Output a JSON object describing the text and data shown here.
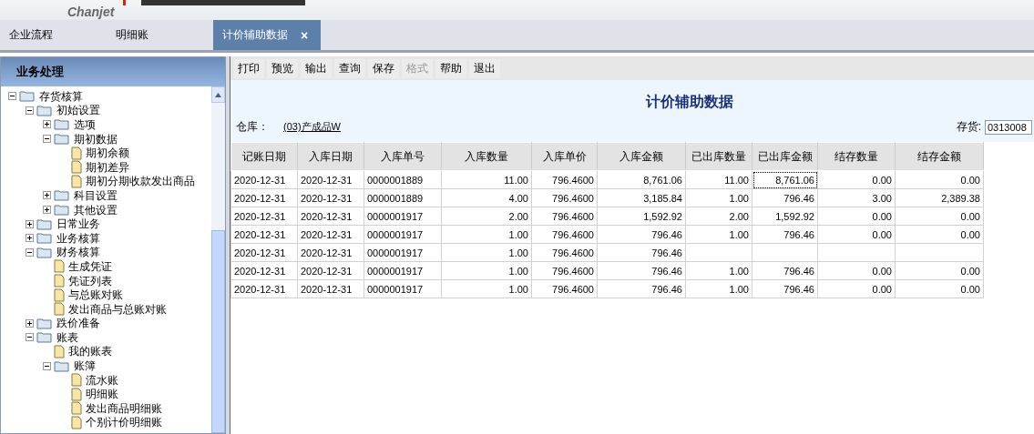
{
  "banner": {
    "logo": "Chanjet"
  },
  "tabs": [
    {
      "label": "企业流程",
      "selected": false
    },
    {
      "label": "明细账",
      "selected": false
    },
    {
      "label": "计价辅助数据",
      "selected": true,
      "close": "×"
    }
  ],
  "sidebar": {
    "title": "业务处理",
    "tree": [
      {
        "label": "存货核算",
        "kind": "folder",
        "expanded": true,
        "children": [
          {
            "label": "初始设置",
            "kind": "folder",
            "expanded": true,
            "children": [
              {
                "label": "选项",
                "kind": "folder",
                "expanded": false
              },
              {
                "label": "期初数据",
                "kind": "folder",
                "expanded": true,
                "children": [
                  {
                    "label": "期初余额",
                    "kind": "doc"
                  },
                  {
                    "label": "期初差异",
                    "kind": "doc"
                  },
                  {
                    "label": "期初分期收款发出商品",
                    "kind": "doc"
                  }
                ]
              },
              {
                "label": "科目设置",
                "kind": "folder",
                "expanded": false
              },
              {
                "label": "其他设置",
                "kind": "folder",
                "expanded": false
              }
            ]
          },
          {
            "label": "日常业务",
            "kind": "folder",
            "expanded": false
          },
          {
            "label": "业务核算",
            "kind": "folder",
            "expanded": false
          },
          {
            "label": "财务核算",
            "kind": "folder",
            "expanded": true,
            "children": [
              {
                "label": "生成凭证",
                "kind": "doc"
              },
              {
                "label": "凭证列表",
                "kind": "doc"
              },
              {
                "label": "与总账对账",
                "kind": "doc"
              },
              {
                "label": "发出商品与总账对账",
                "kind": "doc"
              }
            ]
          },
          {
            "label": "跌价准备",
            "kind": "folder",
            "expanded": false
          },
          {
            "label": "账表",
            "kind": "folder",
            "expanded": true,
            "children": [
              {
                "label": "我的账表",
                "kind": "doc"
              },
              {
                "label": "账簿",
                "kind": "folder",
                "expanded": true,
                "children": [
                  {
                    "label": "流水账",
                    "kind": "doc"
                  },
                  {
                    "label": "明细账",
                    "kind": "doc"
                  },
                  {
                    "label": "发出商品明细账",
                    "kind": "doc"
                  },
                  {
                    "label": "个别计价明细账",
                    "kind": "doc"
                  }
                ]
              }
            ]
          }
        ]
      }
    ]
  },
  "toolbar": [
    {
      "label": "打印",
      "disabled": false
    },
    {
      "label": "预览",
      "disabled": false
    },
    {
      "label": "输出",
      "disabled": false
    },
    {
      "label": "查询",
      "disabled": false
    },
    {
      "label": "保存",
      "disabled": false
    },
    {
      "label": "格式",
      "disabled": true
    },
    {
      "label": "帮助",
      "disabled": false
    },
    {
      "label": "退出",
      "disabled": false
    }
  ],
  "report": {
    "title": "计价辅助数据",
    "warehouse_label": "仓库：",
    "warehouse": "(03)产成品W",
    "inventory_label": "存货:",
    "inventory": "0313008"
  },
  "table": {
    "columns": [
      {
        "label": "记账日期",
        "kind": "text",
        "current": false
      },
      {
        "label": "入库日期",
        "kind": "text",
        "current": false
      },
      {
        "label": "入库单号",
        "kind": "text",
        "current": false
      },
      {
        "label": "入库数量",
        "kind": "number",
        "current": false
      },
      {
        "label": "入库单价",
        "kind": "number",
        "current": false
      },
      {
        "label": "入库金额",
        "kind": "number",
        "current": false
      },
      {
        "label": "已出库数量",
        "kind": "number",
        "current": false
      },
      {
        "label": "已出库金额",
        "kind": "number",
        "current": true
      },
      {
        "label": "结存数量",
        "kind": "number",
        "current": false
      },
      {
        "label": "结存金额",
        "kind": "number",
        "current": false
      }
    ],
    "rows": [
      {
        "selected": true,
        "cells": [
          "2020-12-31",
          "2020-12-31",
          "0000001889",
          "11.00",
          "796.4600",
          "8,761.06",
          "11.00",
          "8,761.06",
          "0.00",
          "0.00"
        ]
      },
      {
        "selected": false,
        "cells": [
          "2020-12-31",
          "2020-12-31",
          "0000001889",
          "4.00",
          "796.4600",
          "3,185.84",
          "1.00",
          "796.46",
          "3.00",
          "2,389.38"
        ]
      },
      {
        "selected": false,
        "cells": [
          "2020-12-31",
          "2020-12-31",
          "0000001917",
          "2.00",
          "796.4600",
          "1,592.92",
          "2.00",
          "1,592.92",
          "0.00",
          "0.00"
        ]
      },
      {
        "selected": false,
        "cells": [
          "2020-12-31",
          "2020-12-31",
          "0000001917",
          "1.00",
          "796.4600",
          "796.46",
          "1.00",
          "796.46",
          "0.00",
          "0.00"
        ]
      },
      {
        "selected": false,
        "cells": [
          "2020-12-31",
          "2020-12-31",
          "0000001917",
          "1.00",
          "796.4600",
          "796.46",
          "",
          "",
          "",
          ""
        ]
      },
      {
        "selected": false,
        "cells": [
          "2020-12-31",
          "2020-12-31",
          "0000001917",
          "1.00",
          "796.4600",
          "796.46",
          "1.00",
          "796.46",
          "0.00",
          "0.00"
        ]
      },
      {
        "selected": false,
        "cells": [
          "2020-12-31",
          "2020-12-31",
          "0000001917",
          "1.00",
          "796.4600",
          "796.46",
          "1.00",
          "796.46",
          "0.00",
          "0.00"
        ]
      }
    ]
  }
}
